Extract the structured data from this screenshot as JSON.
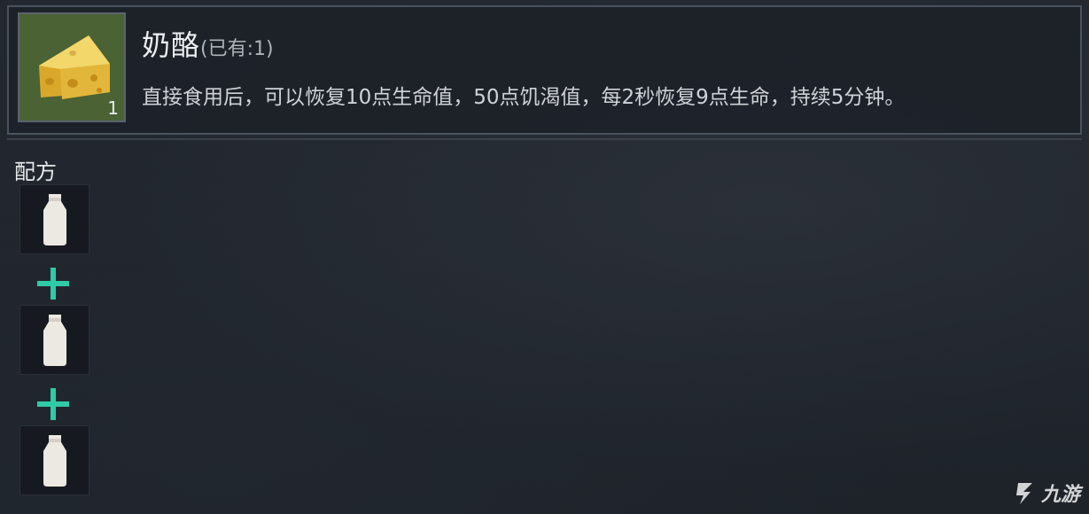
{
  "item": {
    "name": "奶酪",
    "owned": "(已有:1)",
    "count": "1",
    "description": "直接食用后，可以恢复10点生命值，50点饥渴值，每2秒恢复9点生命，持续5分钟。",
    "icon": "cheese-icon"
  },
  "recipe": {
    "title": "配方",
    "ingredients": [
      {
        "icon": "milk-bottle-icon"
      },
      {
        "icon": "milk-bottle-icon"
      },
      {
        "icon": "milk-bottle-icon"
      }
    ],
    "separator_icon": "plus-icon"
  },
  "colors": {
    "accent_plus": "#2fcaa6",
    "item_slot_bg": "#4a6234",
    "panel_border": "#4a525e"
  },
  "watermark": {
    "text": "九游"
  }
}
